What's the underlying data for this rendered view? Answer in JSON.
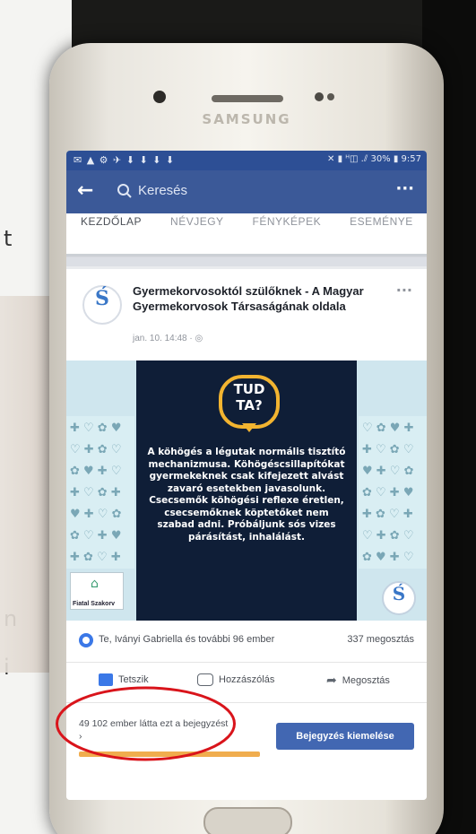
{
  "background": {
    "edge_letters": [
      "t",
      "n",
      "i"
    ]
  },
  "phone": {
    "brand": "SAMSUNG"
  },
  "status_bar": {
    "left_icons": "✉ ▲ ⚙ ✈ ⬇ ⬇ ⬇ ⬇",
    "right": "✕ ▮ ᴴ◫ .⫽ 30% ▮ 9:57"
  },
  "header": {
    "back_glyph": "←",
    "search_placeholder": "Keresés",
    "more_glyph": "···"
  },
  "tabs": [
    {
      "label": "KEZDŐLAP",
      "active": true
    },
    {
      "label": "NÉVJEGY",
      "active": false
    },
    {
      "label": "FÉNYKÉPEK",
      "active": false
    },
    {
      "label": "ESEMÉNYE",
      "active": false
    }
  ],
  "post": {
    "title": "Gyermekorvosoktól szülőknek - A Magyar Gyermekorvosok Társaságának oldala",
    "meta": "jan. 10. 14:48 · ◎",
    "menu_glyph": "···",
    "avatar_glyph": "Ś"
  },
  "image": {
    "badge_line1": "TUD",
    "badge_line2": "TA?",
    "body": "A köhögés a légutak normális tisztító mechanizmusa. Köhögéscsillapítókat gyermekeknek csak kifejezett alvást zavaró esetekben javasolunk. Csecsemők köhögési reflexe éretlen, csecsemőknek köptetőket nem szabad adni. Próbáljunk sós vizes párásítást, inhalálást.",
    "left_logo_text": "Fiatal Szakorv",
    "right_logo_glyph": "Ś"
  },
  "reactions": {
    "text": "Te, Iványi Gabriella és további 96 ember",
    "shares": "337 megosztás"
  },
  "actions": {
    "like": "Tetszik",
    "comment": "Hozzászólás",
    "share": "Megosztás"
  },
  "reach": {
    "text": "49 102 ember látta ezt a bejegyzést ›",
    "progress": 0.62,
    "boost_label": "Bejegyzés kiemelése"
  },
  "colors": {
    "facebook_blue": "#3b5998",
    "boost_blue": "#4267b2",
    "reach_bar": "#f0ad4e",
    "annotation_red": "#d9141b",
    "tudta_bg": "#0f1e37",
    "tudta_badge": "#f2b430"
  }
}
